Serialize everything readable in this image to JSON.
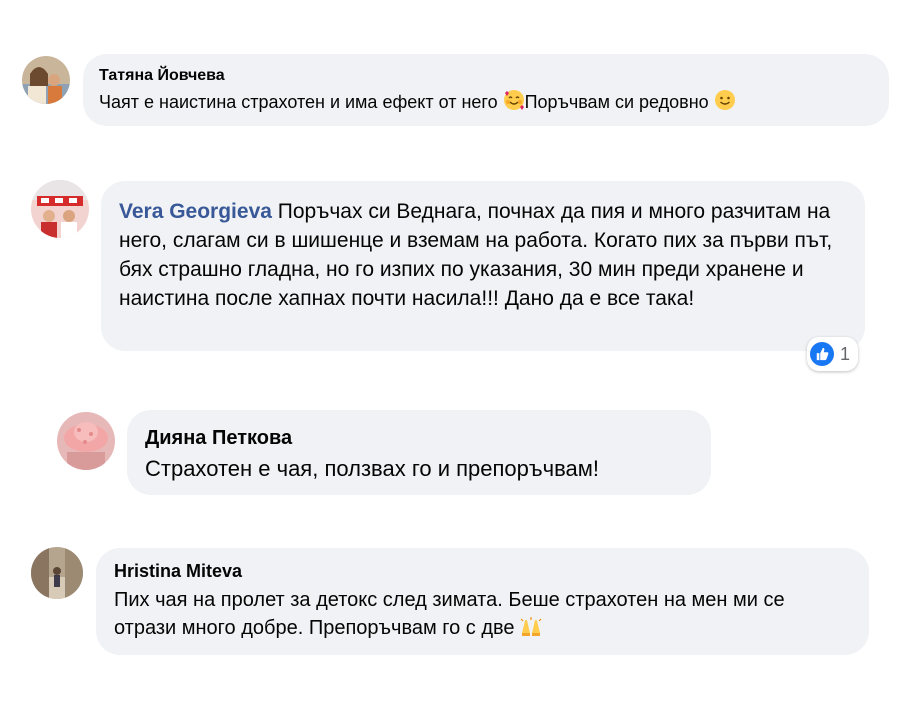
{
  "comments": [
    {
      "author": "Татяна Йовчева",
      "text_part1": "Чаят е наистина страхотен и има ефект от него",
      "text_part2": "Поръчвам си редовно",
      "emoji1": "smiling-face-with-hearts-icon",
      "emoji2": "smiling-face-icon"
    },
    {
      "author": "Vera Georgieva",
      "text": "Поръчах си Веднага, почнах да пия и много разчитам на него, слагам си в шишенце и вземам на работа. Когато пих за първи път, бях страшно гладна, но го изпих по указания, 30 мин преди хранене и наистина после хапнах почти насила!!! Дано да е все така!",
      "reaction_count": "1",
      "reaction_icon": "like-icon"
    },
    {
      "author": "Дияна Петкова",
      "text": "Страхотен е чая, ползвах го и препоръчвам!"
    },
    {
      "author": "Hristina Miteva",
      "text": "Пих чая на пролет за детокс след зимата. Беше страхотен на мен ми се отрази много добре. Препоръчвам го с две",
      "emoji": "raising-hands-icon"
    }
  ],
  "colors": {
    "bubble": "#f0f2f5",
    "author_link": "#385898",
    "like_blue": "#1877f2"
  }
}
